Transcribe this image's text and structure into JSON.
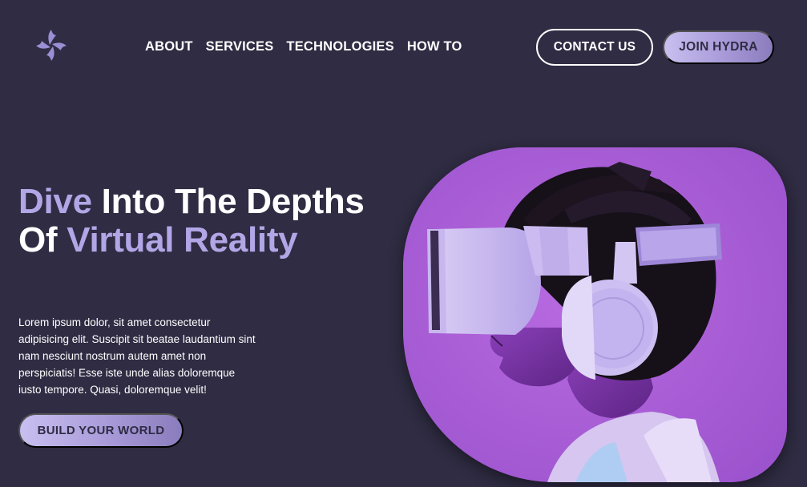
{
  "brand": {
    "logo_icon": "pinwheel-logo-icon",
    "accent_color": "#b2a6e6",
    "background_color": "#2f2c43"
  },
  "nav": {
    "items": [
      {
        "label": "ABOUT"
      },
      {
        "label": "SERVICES"
      },
      {
        "label": "TECHNOLOGIES"
      },
      {
        "label": "HOW TO"
      }
    ]
  },
  "header": {
    "contact_label": "CONTACT US",
    "join_label": "JOIN HYDRA"
  },
  "hero": {
    "title_accent_1": "Dive",
    "title_white_1": " Into The Depths Of ",
    "title_accent_2": "Virtual Reality",
    "description": "Lorem ipsum dolor, sit amet consectetur adipisicing elit. Suscipit sit beatae laudantium sint nam nesciunt nostrum autem amet non perspiciatis! Esse iste unde alias doloremque iusto tempore. Quasi, doloremque velit!",
    "cta_label": "BUILD YOUR WORLD",
    "image": "person-wearing-vr-headset-and-headphones-purple-photo"
  }
}
